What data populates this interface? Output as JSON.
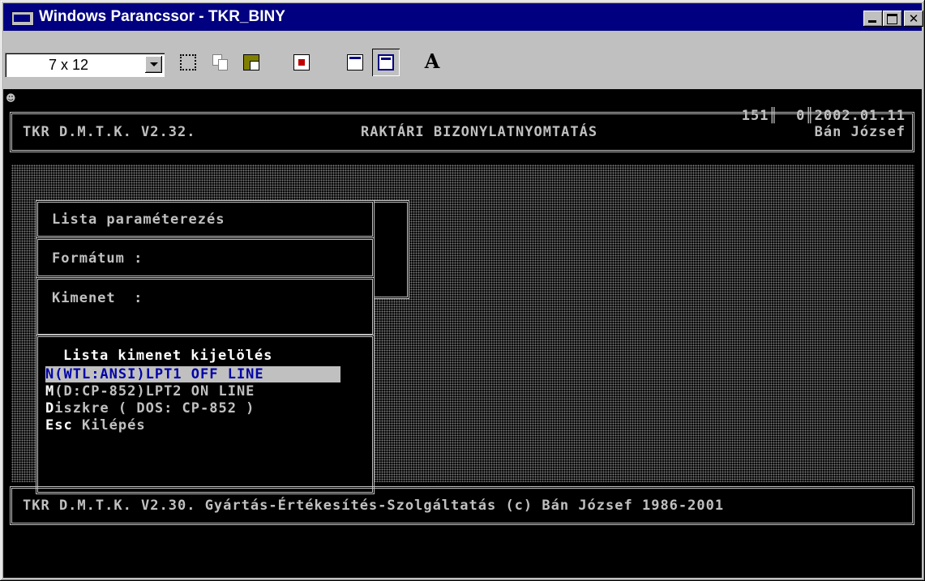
{
  "window": {
    "title": "Windows Parancssor - TKR_BINY",
    "min_label": "",
    "max_label": "",
    "close_label": "✕"
  },
  "toolbar": {
    "font_size": "7 x 12",
    "font_button_label": "A"
  },
  "console": {
    "header": {
      "app": "TKR D.M.T.K. V2.32.",
      "module": "RAKTÁRI BIZONYLATNYOMTATÁS",
      "status": "151║  0║2002.01.11",
      "user": "Bán József"
    },
    "panels": {
      "lista_param": "Lista paraméterezés",
      "formatum": "Formátum :",
      "kimenet": "Kimenet  :"
    },
    "menu": {
      "title": "Lista kimenet kijelölés",
      "items": [
        {
          "hot": "N",
          "rest": "(WTL:ANSI)LPT1 OFF LINE"
        },
        {
          "hot": "M",
          "rest": "(D:CP-852)LPT2 ON LINE"
        },
        {
          "hot": "D",
          "rest": "iszkre ( DOS: CP-852 )"
        },
        {
          "hot": "Esc",
          "rest": " Kilépés"
        }
      ]
    },
    "footer": "TKR D.M.T.K. V2.30. Gyártás-Értékesítés-Szolgáltatás (c) Bán József 1986-2001"
  },
  "colors": {
    "titlebar": "#000080",
    "console_bg": "#000000",
    "console_fg": "#c0c0c0",
    "highlight_bg": "#c0c0c0",
    "highlight_fg": "#0000a8"
  }
}
